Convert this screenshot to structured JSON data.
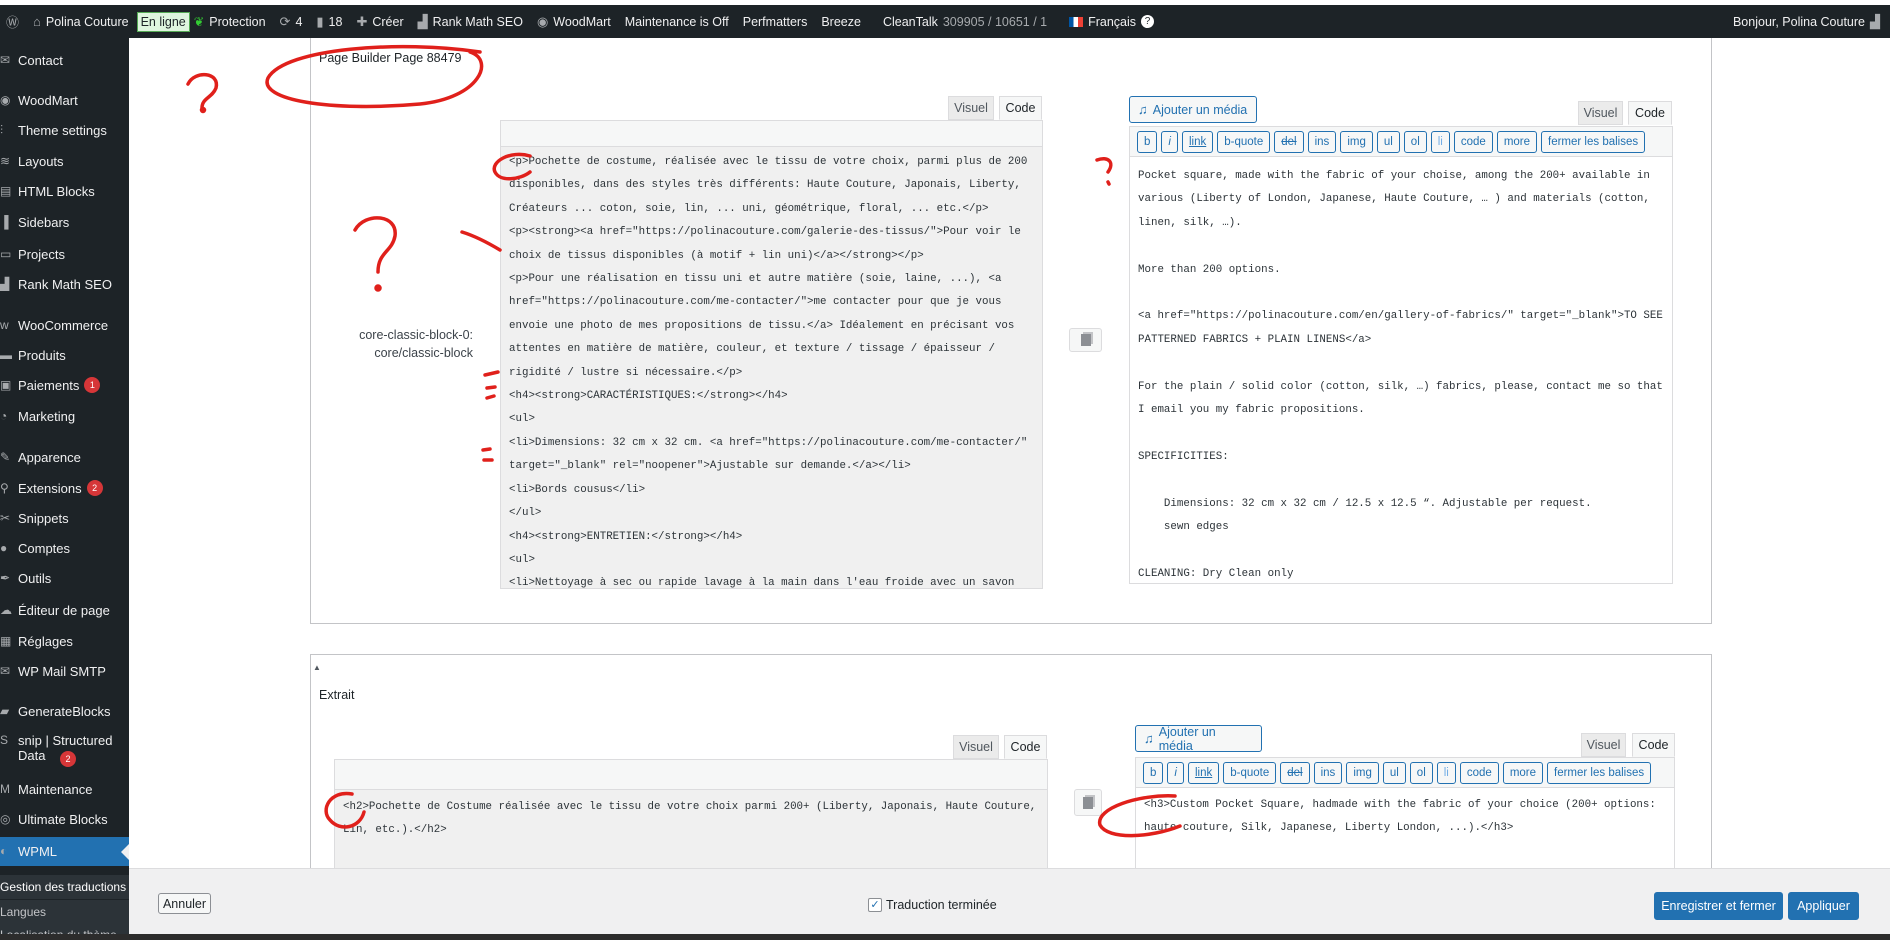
{
  "topbar": {
    "site_name": "Polina Couture",
    "online_badge": "En ligne",
    "protection": "Protection",
    "updates_count": "4",
    "comments_count": "18",
    "create": "Créer",
    "rank_math": "Rank Math SEO",
    "woodmart": "WoodMart",
    "maintenance": "Maintenance is Off",
    "perfmatters": "Perfmatters",
    "breeze": "Breeze",
    "cleantalk": "CleanTalk",
    "cleantalk_stats": "309905 / 10651 / 1",
    "language": "Français",
    "greeting": "Bonjour, Polina Couture"
  },
  "sidebar": {
    "items": [
      {
        "label": "Contact",
        "icon": "mail-icon"
      },
      {
        "label": "WoodMart",
        "icon": "woodmart-icon"
      },
      {
        "label": "Theme settings",
        "icon": "sliders-icon"
      },
      {
        "label": "Layouts",
        "icon": "layers-icon"
      },
      {
        "label": "HTML Blocks",
        "icon": "html-icon"
      },
      {
        "label": "Sidebars",
        "icon": "columns-icon"
      },
      {
        "label": "Projects",
        "icon": "briefcase-icon"
      },
      {
        "label": "Rank Math SEO",
        "icon": "chart-icon"
      },
      {
        "label": "WooCommerce",
        "icon": "woo-icon"
      },
      {
        "label": "Produits",
        "icon": "archive-icon"
      },
      {
        "label": "Paiements",
        "icon": "money-icon",
        "count": "1"
      },
      {
        "label": "Marketing",
        "icon": "megaphone-icon"
      },
      {
        "label": "Apparence",
        "icon": "brush-icon"
      },
      {
        "label": "Extensions",
        "icon": "plugin-icon",
        "count": "2"
      },
      {
        "label": "Snippets",
        "icon": "scissors-icon"
      },
      {
        "label": "Comptes",
        "icon": "user-icon"
      },
      {
        "label": "Outils",
        "icon": "wrench-icon"
      },
      {
        "label": "Éditeur de page",
        "icon": "cloud-icon"
      },
      {
        "label": "Réglages",
        "icon": "settings-icon"
      },
      {
        "label": "WP Mail SMTP",
        "icon": "mail-send-icon"
      },
      {
        "label": "GenerateBlocks",
        "icon": "blocks-icon"
      },
      {
        "label": "snip | Structured Data",
        "icon": "snip-icon",
        "count": "2"
      },
      {
        "label": "Maintenance",
        "icon": "maintenance-icon"
      },
      {
        "label": "Ultimate Blocks",
        "icon": "ultimate-icon"
      },
      {
        "label": "WPML",
        "icon": "wpml-icon"
      }
    ],
    "submenu": [
      "Gestion des traductions",
      "Langues",
      "Localisation du thème"
    ]
  },
  "section1": {
    "title": "Page Builder Page 88479",
    "field_label": "core-classic-block-0: core/classic-block",
    "tab_visual": "Visuel",
    "tab_code": "Code",
    "source_text": "<p>Pochette de costume, réalisée avec le tissu de votre choix, parmi plus de 200 disponibles, dans des styles très différents: Haute Couture, Japonais, Liberty, Créateurs ... coton, soie, lin, ... uni, géométrique, floral, ... etc.</p>\n<p><strong><a href=\"https://polinacouture.com/galerie-des-tissus/\">Pour voir le choix de tissus disponibles (à motif + lin uni)</a></strong></p>\n<p>Pour une réalisation en tissu uni et autre matière (soie, laine, ...), <a href=\"https://polinacouture.com/me-contacter/\">me contacter pour que je vous envoie une photo de mes propositions de tissu.</a> Idéalement en précisant vos attentes en matière de matière, couleur, et texture / tissage / épaisseur / rigidité / lustre si nécessaire.</p>\n<h4><strong>CARACTÉRISTIQUES:</strong></h4>\n<ul>\n<li>Dimensions: 32 cm x 32 cm. <a href=\"https://polinacouture.com/me-contacter/\" target=\"_blank\" rel=\"noopener\">Ajustable sur demande.</a></li>\n<li>Bords cousus</li>\n</ul>\n<h4><strong>ENTRETIEN:</strong></h4>\n<ul>\n<li>Nettoyage à sec ou rapide lavage à la main dans l'eau froide avec un savon neutre, et séchage à l'air ambiant.</li>\n</ul>\n<h4>COMMENT AJOUTER TOUTE PRÉCISION À LA COMMANDE?</h4>\n<p><!-- /wp:heading --></p>\n<p><!-- wp:paragraph --></p>",
    "add_media": "Ajouter un média",
    "translation_text": "Pocket square, made with the fabric of your choise, among the 200+ available in various (Liberty of London, Japanese, Haute Couture, … ) and materials (cotton, linen, silk, …).\n\nMore than 200 options.\n\n<a href=\"https://polinacouture.com/en/gallery-of-fabrics/\" target=\"_blank\">TO SEE PATTERNED FABRICS + PLAIN LINENS</a>\n\nFor the plain / solid color (cotton, silk, …) fabrics, please, contact me so that I email you my fabric propositions.\n\nSPECIFICITIES:\n\n    Dimensions: 32 cm x 32 cm / 12.5 x 12.5 “. Adjustable per request.\n    sewn edges\n\nCLEANING: Dry Clean only\n\nTO INDICATE ME YOUR CHOICE OF FABRIC: when you are validating your order, on bottom left (under section “ship to another address”), you have this specific area (see image) for your comments, and where you can write your fabric choice); or you can also message me."
  },
  "quicktags": [
    "b",
    "i",
    "link",
    "b-quote",
    "del",
    "ins",
    "img",
    "ul",
    "ol",
    "li",
    "code",
    "more",
    "fermer les balises"
  ],
  "section2": {
    "title": "Extrait",
    "tab_visual": "Visuel",
    "tab_code": "Code",
    "source_text": "<h2>Pochette de Costume réalisée avec le tissu de votre choix parmi 200+ (Liberty, Japonais, Haute Couture, Lin, etc.).</h2>",
    "add_media": "Ajouter un média",
    "translation_text": "<h3>Custom Pocket Square, hadmade with the fabric of your choice (200+ options: haute couture, Silk, Japanese, Liberty London, ...).</h3>"
  },
  "footer": {
    "cancel": "Annuler",
    "complete_label": "Traduction terminée",
    "complete_checked": true,
    "save_close": "Enregistrer et fermer",
    "apply": "Appliquer"
  },
  "colors": {
    "accent": "#2271b1",
    "sidebar": "#1d2327",
    "badge": "#d63638",
    "annotation": "#e0201b"
  }
}
